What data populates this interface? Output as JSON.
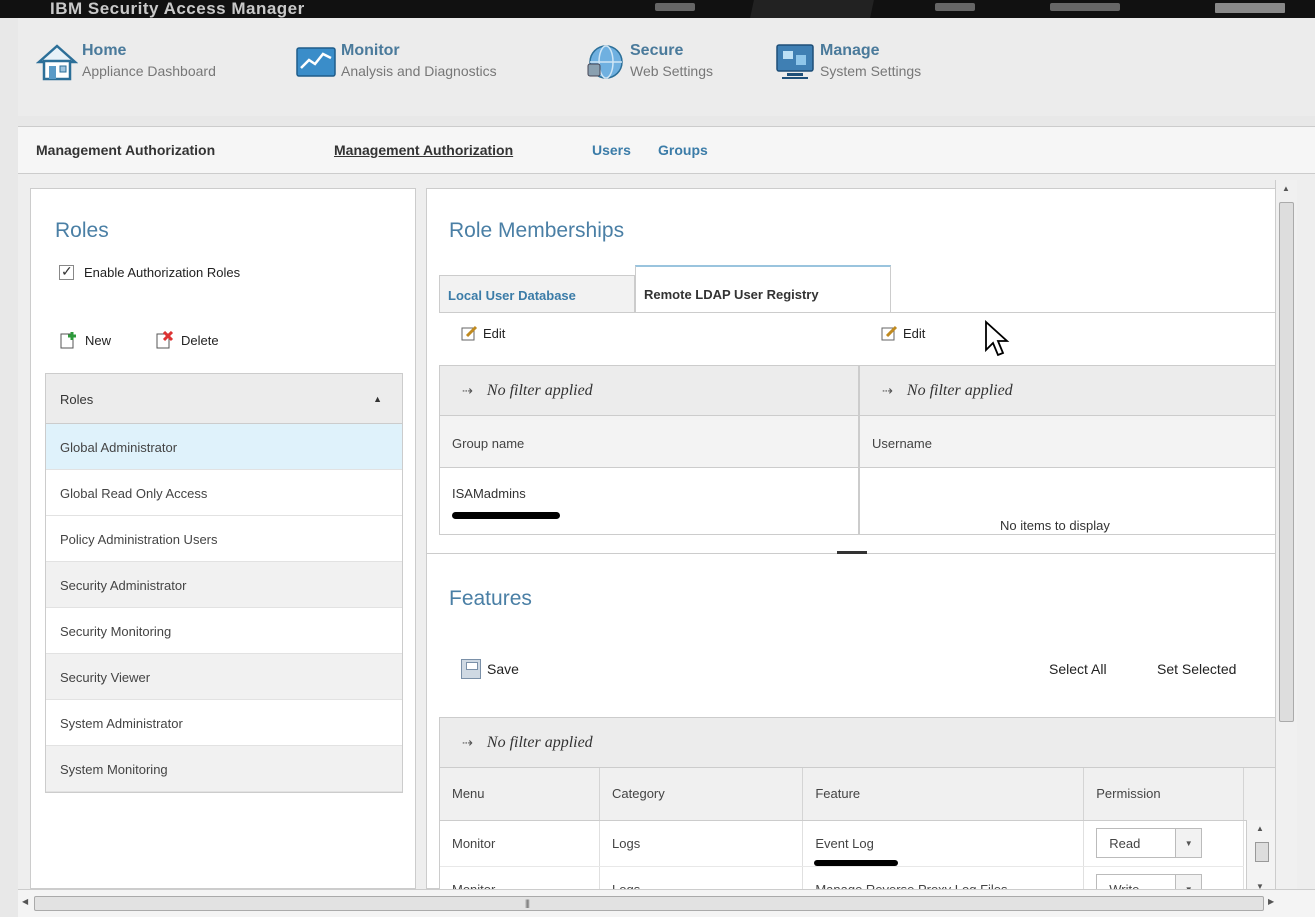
{
  "app": {
    "title": "IBM Security Access Manager"
  },
  "nav": {
    "items": [
      {
        "label": "Home",
        "sub": "Appliance Dashboard"
      },
      {
        "label": "Monitor",
        "sub": "Analysis and Diagnostics"
      },
      {
        "label": "Secure",
        "sub": "Web Settings"
      },
      {
        "label": "Manage",
        "sub": "System Settings"
      }
    ]
  },
  "subnav": {
    "section_label": "Management Authorization",
    "links": [
      "Management Authorization",
      "Users",
      "Groups"
    ]
  },
  "roles": {
    "title": "Roles",
    "enable_label": "Enable Authorization Roles",
    "enabled": true,
    "new_label": "New",
    "delete_label": "Delete",
    "list_header": "Roles",
    "items": [
      "Global Administrator",
      "Global Read Only Access",
      "Policy Administration Users",
      "Security Administrator",
      "Security Monitoring",
      "Security Viewer",
      "System Administrator",
      "System Monitoring"
    ],
    "selected": "Global Administrator"
  },
  "memberships": {
    "title": "Role Memberships",
    "tabs": [
      "Local User Database",
      "Remote LDAP User Registry"
    ],
    "active_tab": "Remote LDAP User Registry",
    "edit_label": "Edit",
    "filter_text": "No filter applied",
    "group_header": "Group name",
    "groups": [
      "ISAMadmins"
    ],
    "user_header": "Username",
    "empty_text": "No items to display"
  },
  "features": {
    "title": "Features",
    "save_label": "Save",
    "select_all_label": "Select All",
    "set_selected_label": "Set Selected",
    "filter_text": "No filter applied",
    "columns": [
      "Menu",
      "Category",
      "Feature",
      "Permission"
    ],
    "rows": [
      {
        "menu": "Monitor",
        "category": "Logs",
        "feature": "Event Log",
        "permission": "Read"
      },
      {
        "menu": "Monitor",
        "category": "Logs",
        "feature": "Manage Reverse Proxy Log Files",
        "permission": "Write"
      }
    ]
  },
  "colors": {
    "accent": "#4a7fa5",
    "link": "#3b7ca8",
    "selected_row": "#dff2fb"
  },
  "icons": [
    "home-icon",
    "monitor-icon",
    "globe-lock-icon",
    "manage-icon",
    "filter-icon",
    "edit-icon",
    "save-icon",
    "new-icon",
    "delete-icon",
    "sort-up-icon",
    "dropdown-arrow-icon",
    "mouse-cursor-icon"
  ]
}
